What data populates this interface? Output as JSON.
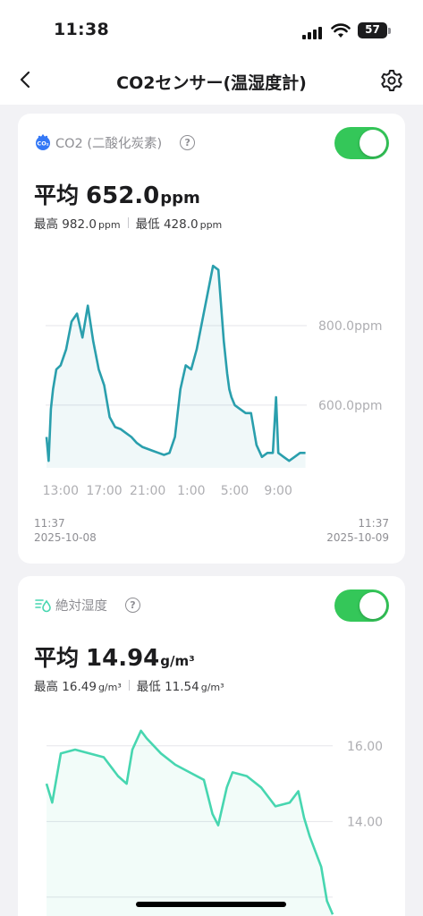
{
  "status_bar": {
    "time": "11:38",
    "battery": "57"
  },
  "nav": {
    "title": "CO2センサー(温湿度計)",
    "back_icon": "chevron-left-icon",
    "settings_icon": "gear-icon"
  },
  "co2": {
    "label": "CO2 (二酸化炭素)",
    "icon": "co2-cloud-icon",
    "enabled": true,
    "avg_label": "平均",
    "avg_value": "652.0",
    "unit": "ppm",
    "max_label": "最高",
    "max_value": "982.0",
    "min_label": "最低",
    "min_value": "428.0",
    "start_time": "11:37",
    "start_date": "2025-10-08",
    "end_time": "11:37",
    "end_date": "2025-10-09"
  },
  "humidity": {
    "label": "絶対湿度",
    "icon": "humidity-drop-icon",
    "enabled": true,
    "avg_label": "平均",
    "avg_value": "14.94",
    "unit": "g/m³",
    "max_label": "最高",
    "max_value": "16.49",
    "min_label": "最低",
    "min_value": "11.54"
  },
  "colors": {
    "co2_line": "#2a9fad",
    "humidity_line": "#47d6b0",
    "toggle_on": "#34c759"
  },
  "chart_data": [
    {
      "type": "line",
      "title": "CO2 (二酸化炭素)",
      "xlabel": "",
      "ylabel": "",
      "x_ticks": [
        "13:00",
        "17:00",
        "21:00",
        "1:00",
        "5:00",
        "9:00"
      ],
      "y_ticks": [
        "600.0ppm",
        "800.0ppm"
      ],
      "x_range": [
        11.617,
        35.617
      ],
      "ylim": [
        420,
        1000
      ],
      "grid": true,
      "series": [
        {
          "x": [
            11.7,
            11.9,
            12.1,
            12.3,
            12.6,
            13.0,
            13.5,
            14.0,
            14.5,
            15.0,
            15.5,
            16.0,
            16.5,
            17.0,
            17.5,
            18.0,
            18.5,
            19.0,
            19.5,
            20.0,
            20.5,
            21.0,
            21.5,
            22.0,
            22.5,
            23.0,
            23.5,
            24.0,
            24.5,
            25.0,
            25.5,
            26.0,
            26.5,
            27.0,
            27.5,
            28.0,
            28.3,
            28.5,
            28.7,
            29.0,
            29.5,
            30.0,
            30.5,
            31.0,
            31.5,
            32.0,
            32.5,
            32.8,
            33.0,
            33.5,
            34.0,
            34.5,
            35.0,
            35.5
          ],
          "y": [
            520,
            460,
            590,
            640,
            690,
            700,
            740,
            810,
            830,
            770,
            850,
            760,
            690,
            650,
            570,
            545,
            540,
            530,
            520,
            505,
            495,
            490,
            485,
            480,
            475,
            480,
            520,
            640,
            700,
            690,
            740,
            810,
            880,
            950,
            940,
            760,
            680,
            640,
            620,
            600,
            590,
            580,
            580,
            500,
            470,
            480,
            480,
            620,
            480,
            470,
            460,
            470,
            480,
            480
          ]
        }
      ]
    },
    {
      "type": "line",
      "title": "絶対湿度",
      "xlabel": "",
      "ylabel": "",
      "y_ticks": [
        "14.00",
        "16.00"
      ],
      "ylim": [
        11.5,
        16.8
      ],
      "grid": true,
      "series": [
        {
          "x": [
            0.0,
            0.02,
            0.05,
            0.1,
            0.15,
            0.2,
            0.25,
            0.28,
            0.3,
            0.33,
            0.35,
            0.4,
            0.45,
            0.5,
            0.55,
            0.58,
            0.6,
            0.63,
            0.65,
            0.7,
            0.75,
            0.8,
            0.85,
            0.88,
            0.9,
            0.92,
            0.94,
            0.96,
            0.98,
            1.0
          ],
          "y": [
            15.0,
            14.5,
            15.8,
            15.9,
            15.8,
            15.7,
            15.2,
            15.0,
            15.9,
            16.4,
            16.2,
            15.8,
            15.5,
            15.3,
            15.1,
            14.2,
            13.9,
            14.9,
            15.3,
            15.2,
            14.9,
            14.4,
            14.5,
            14.8,
            14.1,
            13.6,
            13.2,
            12.8,
            11.9,
            11.54
          ]
        }
      ]
    }
  ]
}
